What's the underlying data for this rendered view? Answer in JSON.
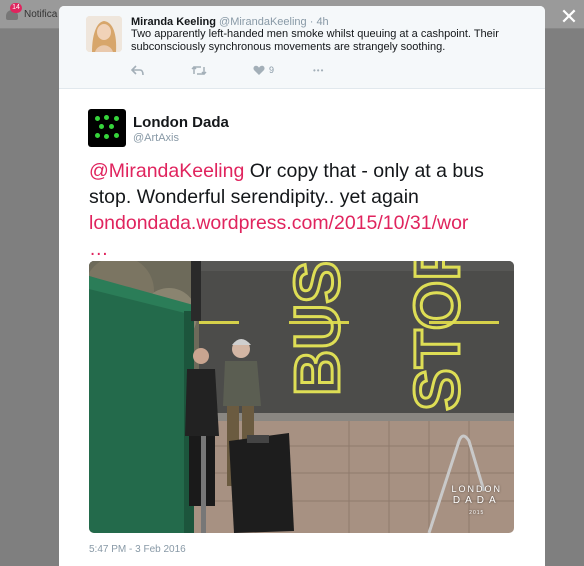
{
  "background": {
    "notification_badge": "14",
    "notification_label": "Notifica"
  },
  "close_glyph": "✕",
  "ancestor_tweet": {
    "name": "Miranda Keeling",
    "handle": "@MirandaKeeling",
    "separator": "·",
    "time": "4h",
    "text": "Two apparently left-handed men smoke whilst queuing at a cashpoint. Their subconsciously synchronous movements are strangely soothing.",
    "actions": {
      "reply_icon": "reply-icon",
      "retweet_icon": "retweet-icon",
      "like_icon": "heart-icon",
      "like_count": "9",
      "more_icon": "more-icon",
      "more_glyph": "•••"
    }
  },
  "main_tweet": {
    "name": "London Dada",
    "handle": "@ArtAxis",
    "mention": "@MirandaKeeling",
    "text_after_mention": " Or copy that - only at a bus stop. Wonderful serendipity.. yet again ",
    "link_text": "londondada.wordpress.com/2015/10/31/wor",
    "link_ellipsis": "…",
    "timestamp": "5:47 PM - 3 Feb 2016",
    "photo": {
      "watermark_line1": "LONDON",
      "watermark_line2": "DADA",
      "watermark_line3": "2015",
      "road_text_1": "BUS",
      "road_text_2": "STOP"
    }
  },
  "colors": {
    "link": "#e0245e",
    "muted": "#8899a6",
    "avatar_dots": "#36d43b"
  }
}
